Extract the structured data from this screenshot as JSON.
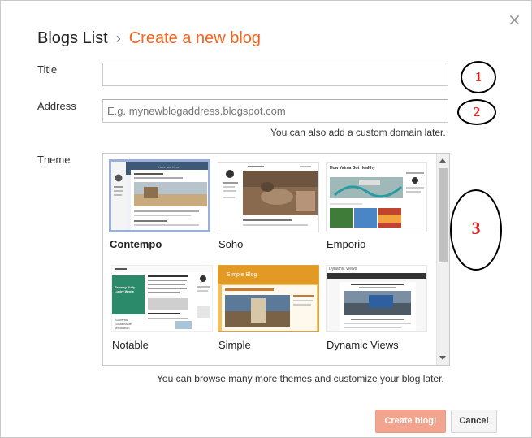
{
  "header": {
    "breadcrumb_parent": "Blogs List",
    "separator": "›",
    "title": "Create a new blog",
    "close_glyph": "×"
  },
  "form": {
    "title_label": "Title",
    "title_value": "",
    "address_label": "Address",
    "address_placeholder": "E.g. mynewblogaddress.blogspot.com",
    "address_hint": "You can also add a custom domain later.",
    "theme_label": "Theme"
  },
  "themes": [
    {
      "name": "Contempo",
      "selected": true
    },
    {
      "name": "Soho",
      "selected": false
    },
    {
      "name": "Emporio",
      "selected": false
    },
    {
      "name": "Notable",
      "selected": false
    },
    {
      "name": "Simple",
      "selected": false
    },
    {
      "name": "Dynamic Views",
      "selected": false
    }
  ],
  "theme_previews": {
    "contempo_header": "Here are Here",
    "emporio_title": "How Yaima Got Healthy",
    "notable_text": "Bravery Fully Lucky Wrote",
    "notable_caption": "Authentic Sustainable Meditation",
    "simple_title": "Simple Blog",
    "dynamic_title": "Dynamic Views"
  },
  "theme_hint": "You can browse many more themes and customize your blog later.",
  "buttons": {
    "create": "Create blog!",
    "cancel": "Cancel"
  },
  "annotations": [
    "1",
    "2",
    "3"
  ],
  "colors": {
    "accent": "#f26522",
    "annotation": "#e02020",
    "create_button": "#f2a48e",
    "selected_border": "#9ab0d8"
  }
}
